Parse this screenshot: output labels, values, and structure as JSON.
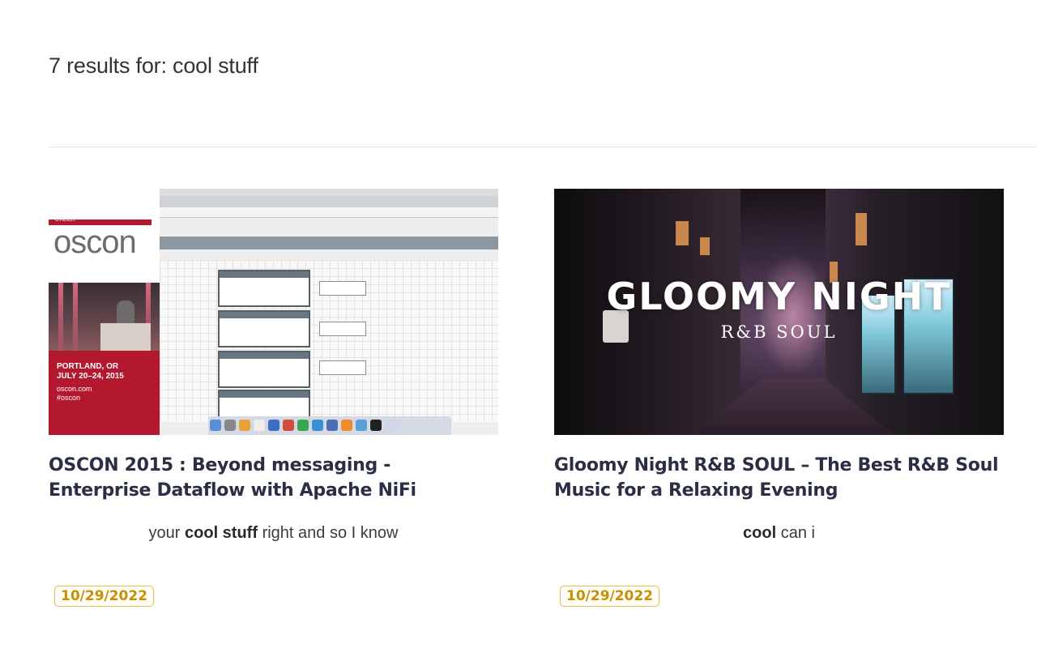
{
  "search": {
    "heading": "7 results for: cool stuff"
  },
  "results": [
    {
      "title": "OSCON 2015 : Beyond messaging - Enterprise Dataflow with Apache NiFi",
      "snippet_before": "your ",
      "snippet_highlight": "cool stuff",
      "snippet_after": " right and so I know",
      "date": "10/29/2022",
      "thumbnail": {
        "brand_small": "O'REILLY",
        "brand": "OSCON",
        "location": "PORTLAND, OR",
        "dates": "JULY 20–24, 2015",
        "site": "oscon.com",
        "hashtag": "#oscon"
      }
    },
    {
      "title": "Gloomy Night R&B SOUL – The Best R&B Soul Music for a Relaxing Evening",
      "snippet_before": "",
      "snippet_highlight": "cool",
      "snippet_after": " can i",
      "date": "10/29/2022",
      "thumbnail": {
        "headline": "GLOOMY NIGHT",
        "subheadline": "R&B SOUL"
      }
    }
  ],
  "colors": {
    "title": "#2b2f45",
    "date_border": "#e7b84a",
    "date_text": "#c98e07",
    "oscon_red": "#b3182f"
  }
}
